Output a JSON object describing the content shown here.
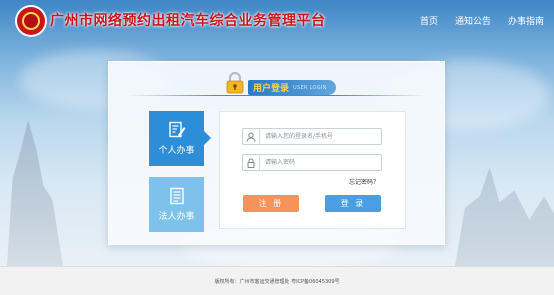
{
  "header": {
    "title": "广州市网络预约出租汽车综合业务管理平台",
    "nav": [
      "首页",
      "通知公告",
      "办事指南"
    ]
  },
  "login": {
    "title_zh": "用户登录",
    "title_en": "USER LOGIN",
    "tabs": [
      {
        "label": "个人办事",
        "icon": "document-edit-icon",
        "active": true
      },
      {
        "label": "法人办事",
        "icon": "document-list-icon",
        "active": false
      }
    ],
    "username_placeholder": "请输入您的登录名/手机号",
    "password_placeholder": "请输入密码",
    "forgot_label": "忘记密码？",
    "register_label": "注 册",
    "login_label": "登 录"
  },
  "footer": {
    "text": "版权所有：广州市客运交通管理处  粤ICP备06045309号"
  },
  "colors": {
    "title_red": "#c8161d",
    "tab_active": "#2c8ed9",
    "tab_inactive": "#7ec2ec",
    "register": "#f6935a",
    "login": "#4a9ee3"
  }
}
